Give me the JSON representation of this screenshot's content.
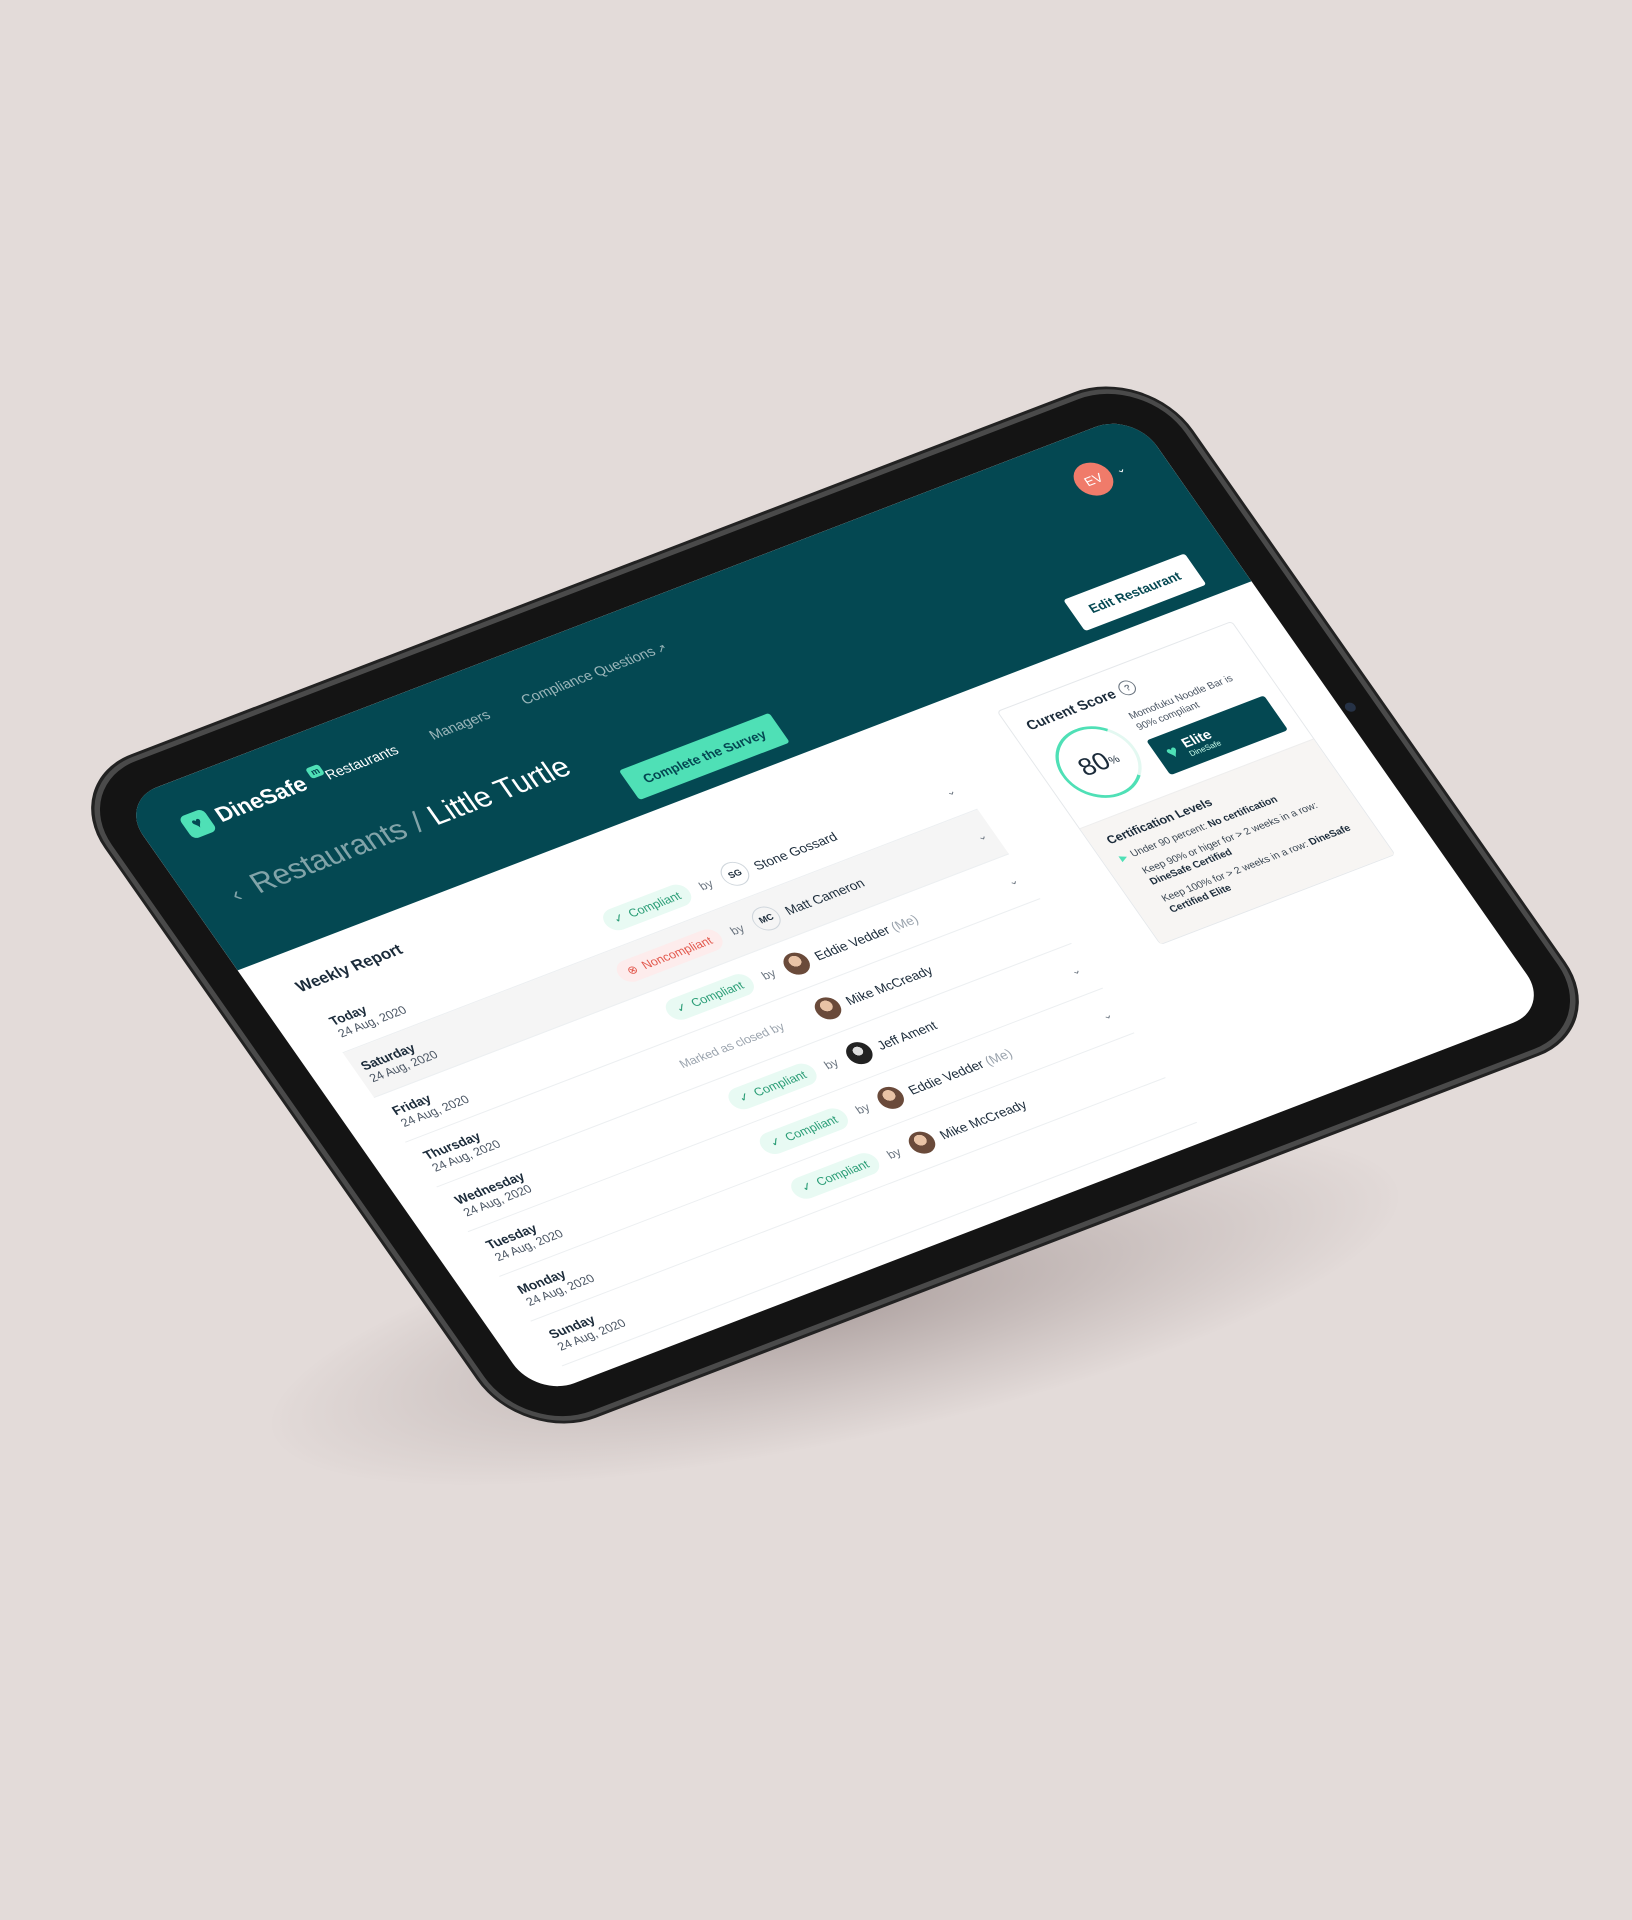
{
  "brand": {
    "name": "DineSafe",
    "badge": "m"
  },
  "nav": {
    "items": [
      "Restaurants",
      "Managers",
      "Compliance Questions"
    ],
    "external_icon": "arrow-up-right-icon"
  },
  "user": {
    "initials": "EV"
  },
  "breadcrumb": {
    "parent": "Restaurants",
    "separator": "/",
    "current": "Little Turtle"
  },
  "actions": {
    "survey": "Complete the Survey",
    "edit": "Edit Restaurant"
  },
  "report": {
    "title": "Weekly Report",
    "by_label": "by",
    "rows": [
      {
        "day": "Today",
        "date": "24 Aug, 2020",
        "status": "Compliant",
        "initials": "SG",
        "person": "Stone Gossard",
        "me": ""
      },
      {
        "day": "Saturday",
        "date": "24 Aug, 2020",
        "status": "Noncompliant",
        "initials": "MC",
        "person": "Matt Cameron",
        "me": ""
      },
      {
        "day": "Friday",
        "date": "24 Aug, 2020",
        "status": "Compliant",
        "initials": "",
        "person": "Eddie Vedder",
        "me": "(Me)"
      },
      {
        "day": "Thursday",
        "date": "24 Aug, 2020",
        "status": "Marked as closed by",
        "initials": "",
        "person": "Mike McCready",
        "me": ""
      },
      {
        "day": "Wednesday",
        "date": "24 Aug, 2020",
        "status": "Compliant",
        "initials": "",
        "person": "Jeff Ament",
        "me": ""
      },
      {
        "day": "Tuesday",
        "date": "24 Aug, 2020",
        "status": "Compliant",
        "initials": "",
        "person": "Eddie Vedder",
        "me": "(Me)"
      },
      {
        "day": "Monday",
        "date": "24 Aug, 2020",
        "status": "Compliant",
        "initials": "",
        "person": "Mike McCready",
        "me": ""
      },
      {
        "day": "Sunday",
        "date": "24 Aug, 2020",
        "status": "",
        "initials": "",
        "person": "",
        "me": ""
      }
    ]
  },
  "score": {
    "title": "Current Score",
    "value": "80",
    "unit": "%",
    "description": "Momofuku Noodle Bar is 90% compliant",
    "badge_name": "Elite",
    "badge_sub": "DineSafe"
  },
  "certification": {
    "title": "Certification Levels",
    "levels": [
      {
        "text": "Under 90 percent: ",
        "bold": "No certification"
      },
      {
        "text": "Keep 90% or higer for > 2 weeks in a row: ",
        "bold": "DineSafe Certified"
      },
      {
        "text": "Keep 100% for > 2 weeks in a row: ",
        "bold": "DineSafe Certified Elite"
      }
    ]
  },
  "colors": {
    "brand": "#044852",
    "accent": "#4fe0b6",
    "danger": "#e2574c",
    "avatar": "#f07b6a",
    "background": "#e3dbd9"
  }
}
